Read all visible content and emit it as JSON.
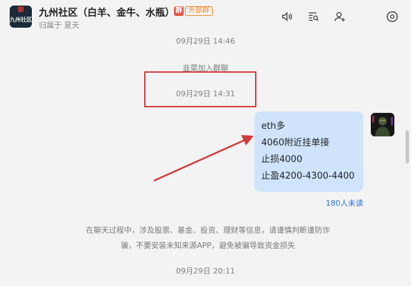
{
  "header": {
    "group_title": "九州社区（白羊、金牛、水瓶）",
    "tag_icon_text": "群",
    "tag_external": "外部群",
    "subtitle": "归属于  夏天",
    "avatar_text_top": "聊",
    "avatar_text": "九州社区",
    "icons": [
      "speaker-icon",
      "search-list-icon",
      "add-member-icon",
      "settings-icon"
    ]
  },
  "messages": {
    "time_top": "09月29日 14:46",
    "system_join": "韭菜加入群聊",
    "time_highlighted": "09月29日 14:31",
    "bubble_lines": [
      "eth多",
      "4060附近挂单接",
      "止损4000",
      "止盈4200-4300-4400"
    ],
    "unread_count": "180人未读",
    "notice_lines": [
      "在聊天过程中，涉及股票、基金、投资、理财等信息，请谨慎判断谨防诈",
      "骗，不要安装未知来源APP，避免被骗导致资金损失"
    ],
    "time_bottom": "09月29日 20:11"
  },
  "colors": {
    "highlight": "#d33b3b",
    "bubble": "#cfe4fb",
    "unread": "#2a74d6",
    "external_tag": "#f08a2a"
  }
}
